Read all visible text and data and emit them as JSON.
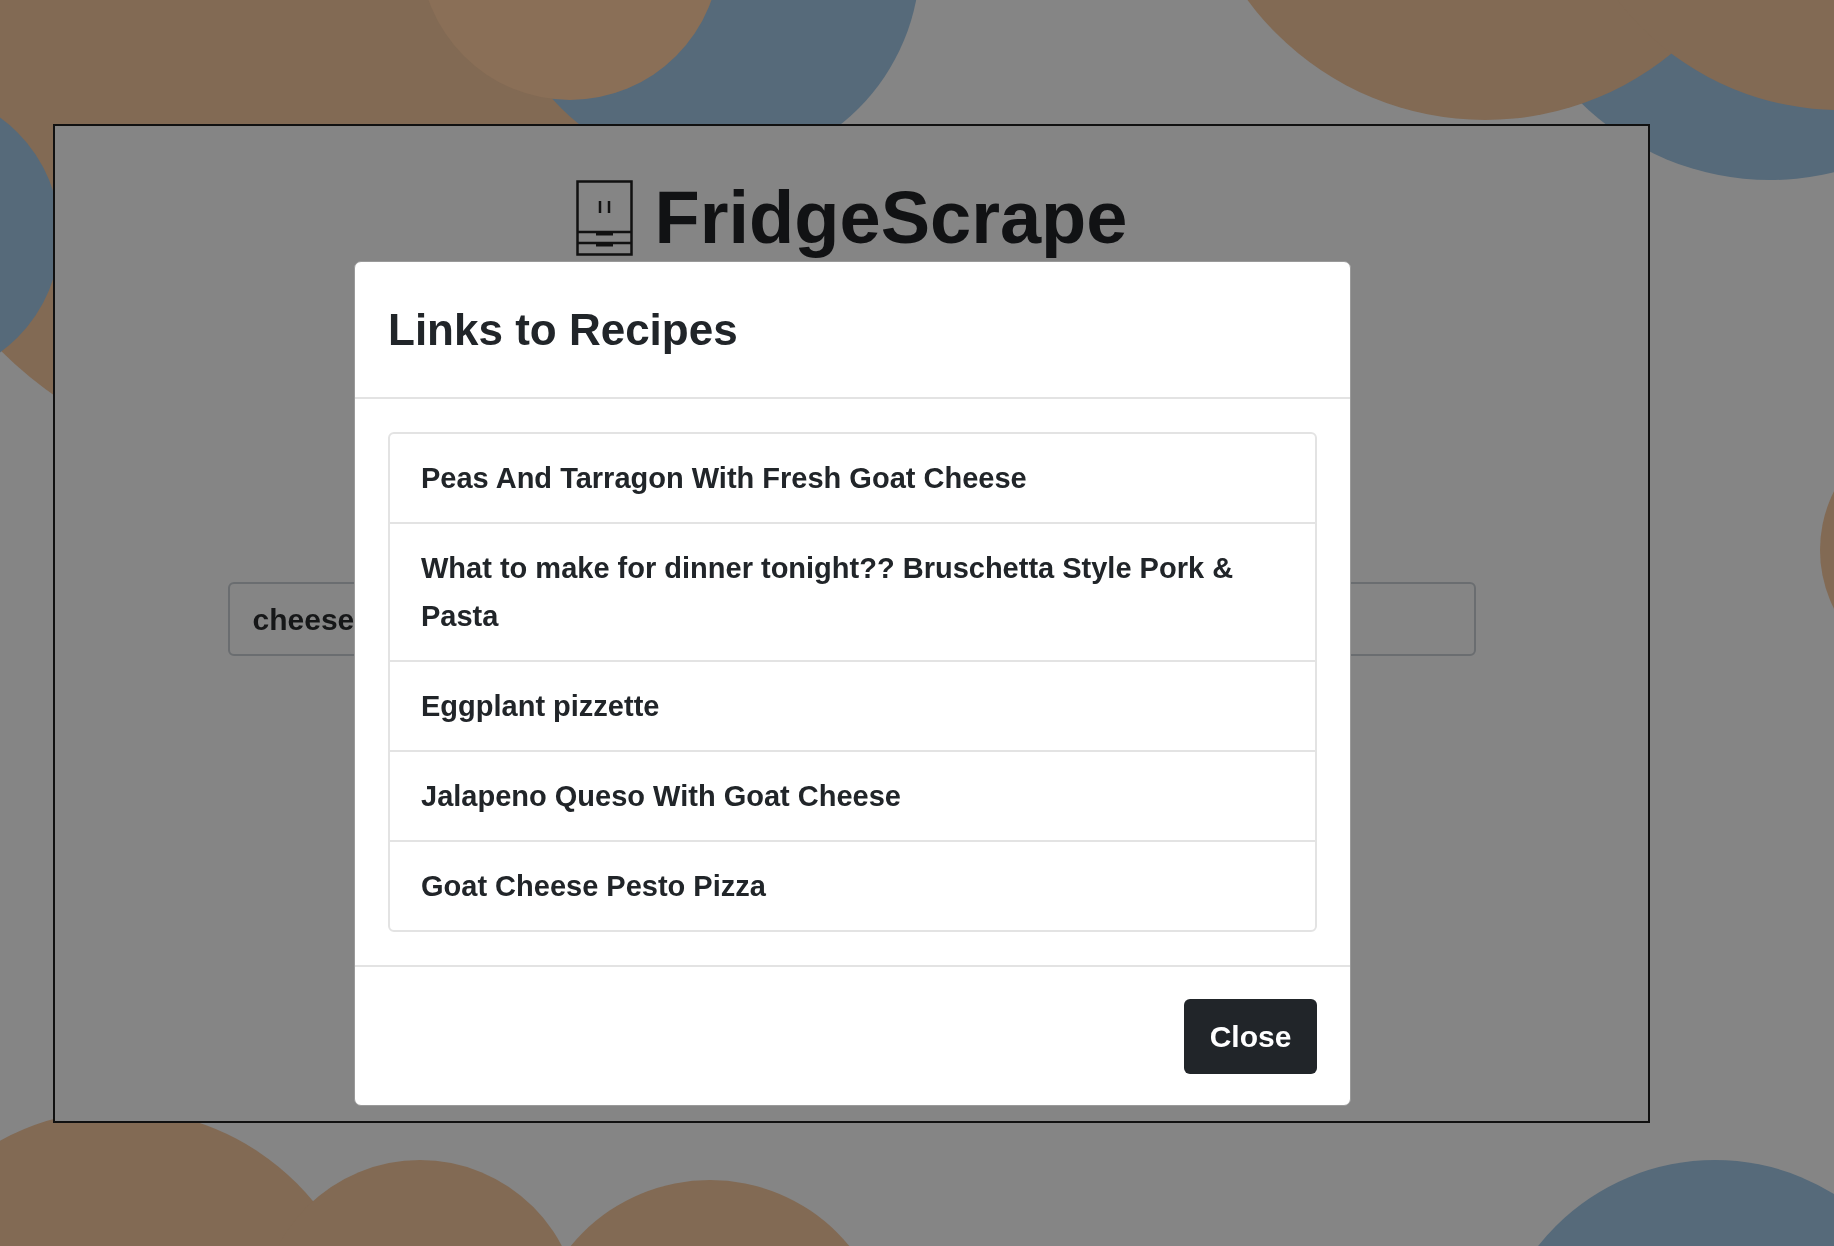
{
  "app": {
    "title": "FridgeScrape"
  },
  "search": {
    "value": "cheese"
  },
  "modal": {
    "title": "Links to Recipes",
    "links": [
      "Peas And Tarragon With Fresh Goat Cheese",
      "What to make for dinner tonight?? Bruschetta Style Pork & Pasta",
      "Eggplant pizzette",
      "Jalapeno Queso With Goat Cheese",
      "Goat Cheese Pesto Pizza"
    ],
    "close_button": "Close"
  }
}
